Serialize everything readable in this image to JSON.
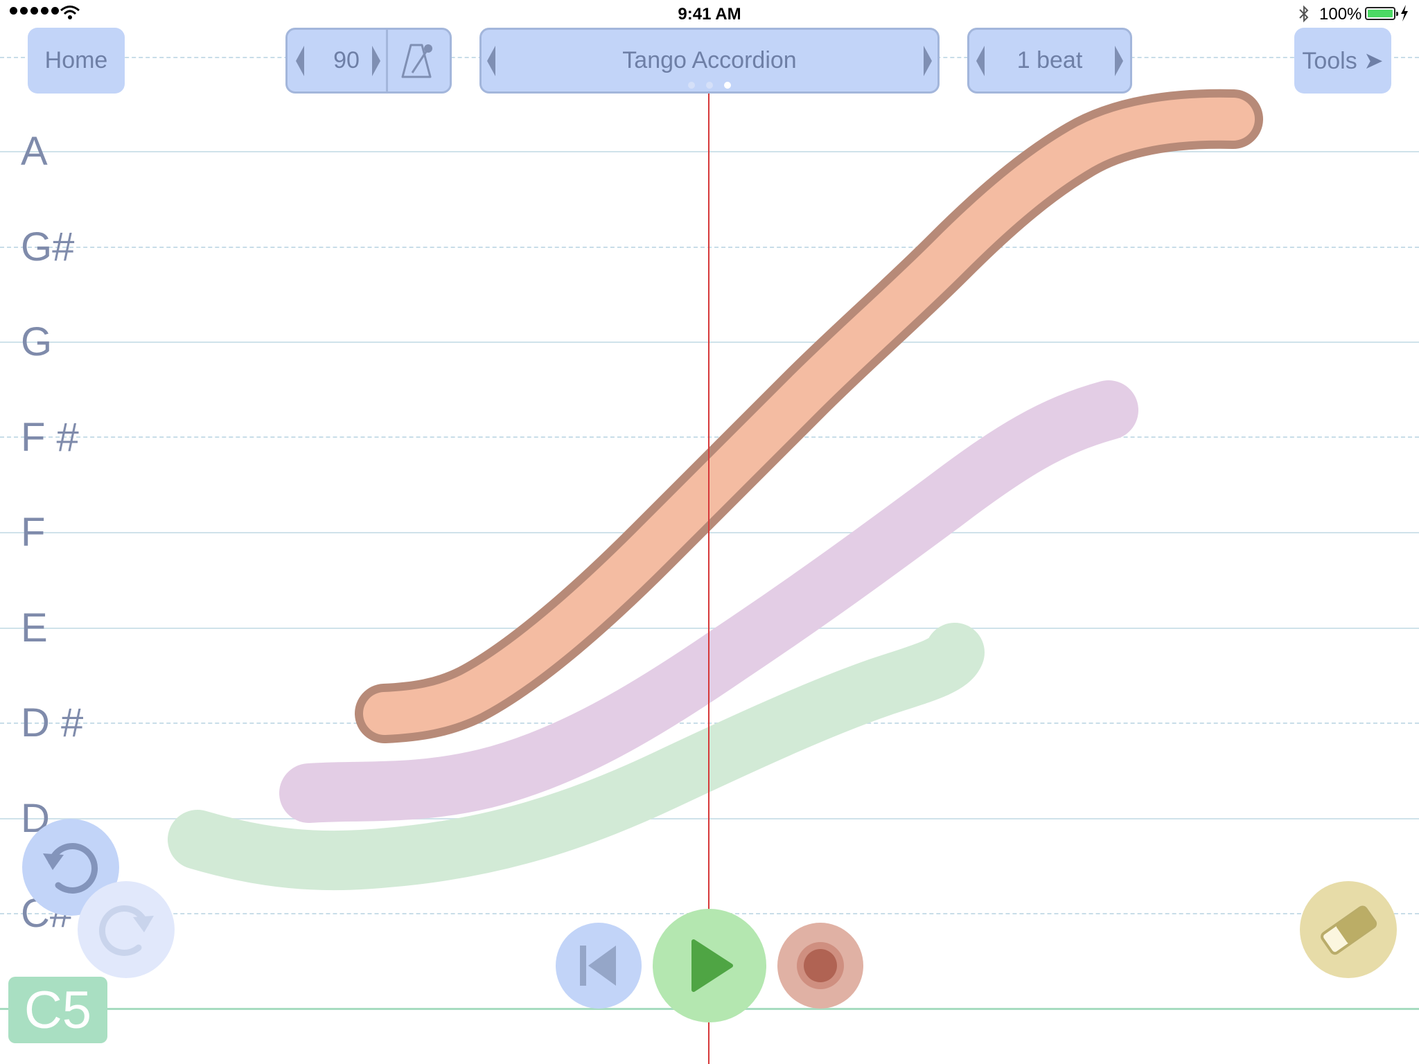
{
  "status_bar": {
    "time": "9:41 AM",
    "battery_percent": "100%",
    "battery_level": 1.0,
    "bluetooth_icon": "bluetooth-icon",
    "wifi_icon": "wifi-icon",
    "signal_icon": "cellular-signal-icon",
    "charging_icon": "charging-bolt-icon"
  },
  "toolbar": {
    "home_label": "Home",
    "tempo_value": "90",
    "metronome_icon": "metronome-icon",
    "instrument_name": "Tango Accordion",
    "instrument_page_count": 3,
    "instrument_page_active": 3,
    "beat_label": "1 beat",
    "tools_label": "Tools ➤"
  },
  "staff": {
    "note_labels": [
      "A",
      "G#",
      "G",
      "F #",
      "F",
      "E",
      "D #",
      "D",
      "C#"
    ],
    "base_note": "C5"
  },
  "strokes": [
    {
      "name": "orange-stroke",
      "color": "#f4bca2",
      "outline": "#b78a78",
      "selected": true
    },
    {
      "name": "purple-stroke",
      "color": "#e3cde5",
      "selected": false
    },
    {
      "name": "green-stroke",
      "color": "#d2ead6",
      "selected": false
    }
  ],
  "controls": {
    "undo_icon": "undo-icon",
    "redo_icon": "redo-icon",
    "rewind_icon": "skip-to-start-icon",
    "play_icon": "play-icon",
    "record_icon": "record-icon",
    "eraser_icon": "eraser-icon"
  },
  "colors": {
    "button_blue": "#c2d4f8",
    "playhead": "#d6393a",
    "play_green": "#b4e7b0",
    "record_red": "#e0b1a4",
    "eraser_yellow": "#e7dca8"
  }
}
